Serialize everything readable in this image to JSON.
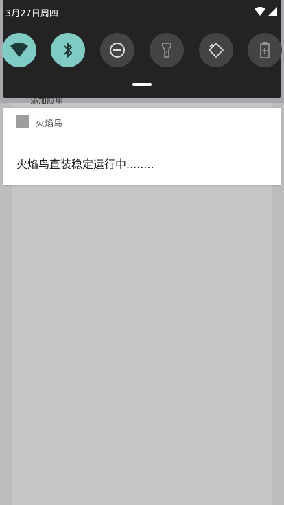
{
  "status_bar": {
    "date": "3月27日周四",
    "icons": [
      "wifi-icon",
      "cell-signal-icon"
    ]
  },
  "quick_settings": {
    "tiles": [
      {
        "name": "wifi",
        "icon": "wifi-icon",
        "state": "on"
      },
      {
        "name": "bluetooth",
        "icon": "bluetooth-icon",
        "state": "on"
      },
      {
        "name": "do-not-disturb",
        "icon": "dnd-icon",
        "state": "off"
      },
      {
        "name": "flashlight",
        "icon": "flashlight-icon",
        "state": "off"
      },
      {
        "name": "auto-rotate",
        "icon": "rotate-icon",
        "state": "off"
      },
      {
        "name": "battery-saver",
        "icon": "battery-icon",
        "state": "off"
      }
    ],
    "accent": "#80cbc4"
  },
  "background": {
    "label": "添加应用"
  },
  "notification": {
    "app_name": "火焰鸟",
    "text": "火焰鸟直装稳定运行中........"
  }
}
